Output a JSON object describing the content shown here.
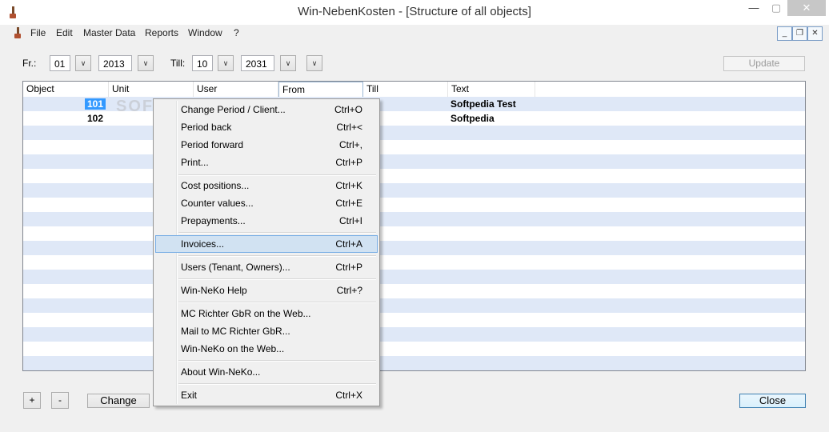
{
  "window": {
    "title": "Win-NebenKosten - [Structure of all objects]",
    "minimize": "—",
    "maximize": "▢",
    "close": "✕"
  },
  "menubar": {
    "items": [
      "File",
      "Edit",
      "Master Data",
      "Reports",
      "Window",
      "?"
    ],
    "mdi_controls": [
      "_",
      "❐",
      "✕"
    ]
  },
  "filter": {
    "from_label": "Fr.:",
    "from_month": "01",
    "from_year": "2013",
    "till_label": "Till:",
    "till_month": "10",
    "till_year": "2031",
    "update_button": "Update",
    "dropdown_arrow": "∨"
  },
  "grid": {
    "columns": [
      "Object",
      "Unit",
      "User",
      "From",
      "Till",
      "Text"
    ],
    "rows": [
      {
        "object": "101",
        "text": "Softpedia Test"
      },
      {
        "object": "102",
        "text": "Softpedia"
      }
    ]
  },
  "context_menu": {
    "items": [
      {
        "label": "Change Period / Client...",
        "shortcut": "Ctrl+O"
      },
      {
        "label": "Period back",
        "shortcut": "Ctrl+<"
      },
      {
        "label": "Period forward",
        "shortcut": "Ctrl+,"
      },
      {
        "label": "Print...",
        "shortcut": "Ctrl+P"
      },
      {
        "label": "Cost positions...",
        "shortcut": "Ctrl+K"
      },
      {
        "label": "Counter values...",
        "shortcut": "Ctrl+E"
      },
      {
        "label": "Prepayments...",
        "shortcut": "Ctrl+I"
      },
      {
        "label": "Invoices...",
        "shortcut": "Ctrl+A"
      },
      {
        "label": "Users (Tenant, Owners)...",
        "shortcut": "Ctrl+P"
      },
      {
        "label": "Win-NeKo Help",
        "shortcut": "Ctrl+?"
      },
      {
        "label": "MC Richter GbR on the Web...",
        "shortcut": ""
      },
      {
        "label": "Mail to MC Richter GbR...",
        "shortcut": ""
      },
      {
        "label": "Win-NeKo on the Web...",
        "shortcut": ""
      },
      {
        "label": "About Win-NeKo...",
        "shortcut": ""
      },
      {
        "label": "Exit",
        "shortcut": "Ctrl+X"
      }
    ]
  },
  "bottom": {
    "add_button": "+",
    "remove_button": "-",
    "change_button": "Change",
    "close_button": "Close"
  },
  "watermark": "SOFTPEDIA",
  "colors": {
    "selection": "#3399ff",
    "row_alt": "#dfe8f7",
    "menu_highlight": "#d1e2f2"
  }
}
